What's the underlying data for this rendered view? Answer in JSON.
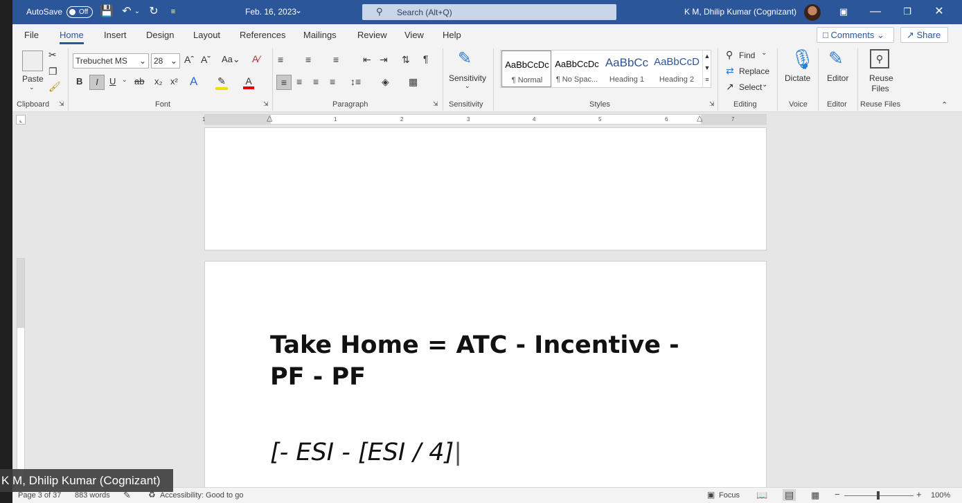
{
  "titlebar": {
    "autosave_label": "AutoSave",
    "autosave_state": "Off",
    "doc_title": "Feb. 16, 2023",
    "search_placeholder": "Search (Alt+Q)",
    "user": "K M, Dhilip Kumar (Cognizant)"
  },
  "tabs": [
    "File",
    "Home",
    "Insert",
    "Design",
    "Layout",
    "References",
    "Mailings",
    "Review",
    "View",
    "Help"
  ],
  "tab_buttons": {
    "comments": "Comments",
    "share": "Share"
  },
  "ribbon": {
    "paste": "Paste",
    "clipboard": "Clipboard",
    "font_name": "Trebuchet MS",
    "font_size": "28",
    "font": "Font",
    "paragraph": "Paragraph",
    "sensitivity": "Sensitivity",
    "styles_group": "Styles",
    "styles": [
      {
        "preview": "AaBbCcDc",
        "name": "¶ Normal"
      },
      {
        "preview": "AaBbCcDc",
        "name": "¶ No Spac..."
      },
      {
        "preview": "AaBbCc",
        "name": "Heading 1"
      },
      {
        "preview": "AaBbCcD",
        "name": "Heading 2"
      }
    ],
    "find": "Find",
    "replace": "Replace",
    "select": "Select",
    "editing": "Editing",
    "dictate": "Dictate",
    "voice": "Voice",
    "editor": "Editor",
    "editor_group": "Editor",
    "reuse_files": "Reuse Files",
    "reuse_files_group": "Reuse Files"
  },
  "ruler_numbers": [
    "1",
    "1",
    "2",
    "3",
    "4",
    "5",
    "6",
    "7"
  ],
  "document": {
    "line1": "Take Home = ATC - Incentive - PF - PF",
    "line2": "[- ESI - [ESI / 4]"
  },
  "status": {
    "page": "Page 3 of 37",
    "words": "883 words",
    "accessibility": "Accessibility: Good to go",
    "focus": "Focus",
    "zoom": "100%"
  },
  "participant_name": "K M, Dhilip Kumar (Cognizant)"
}
